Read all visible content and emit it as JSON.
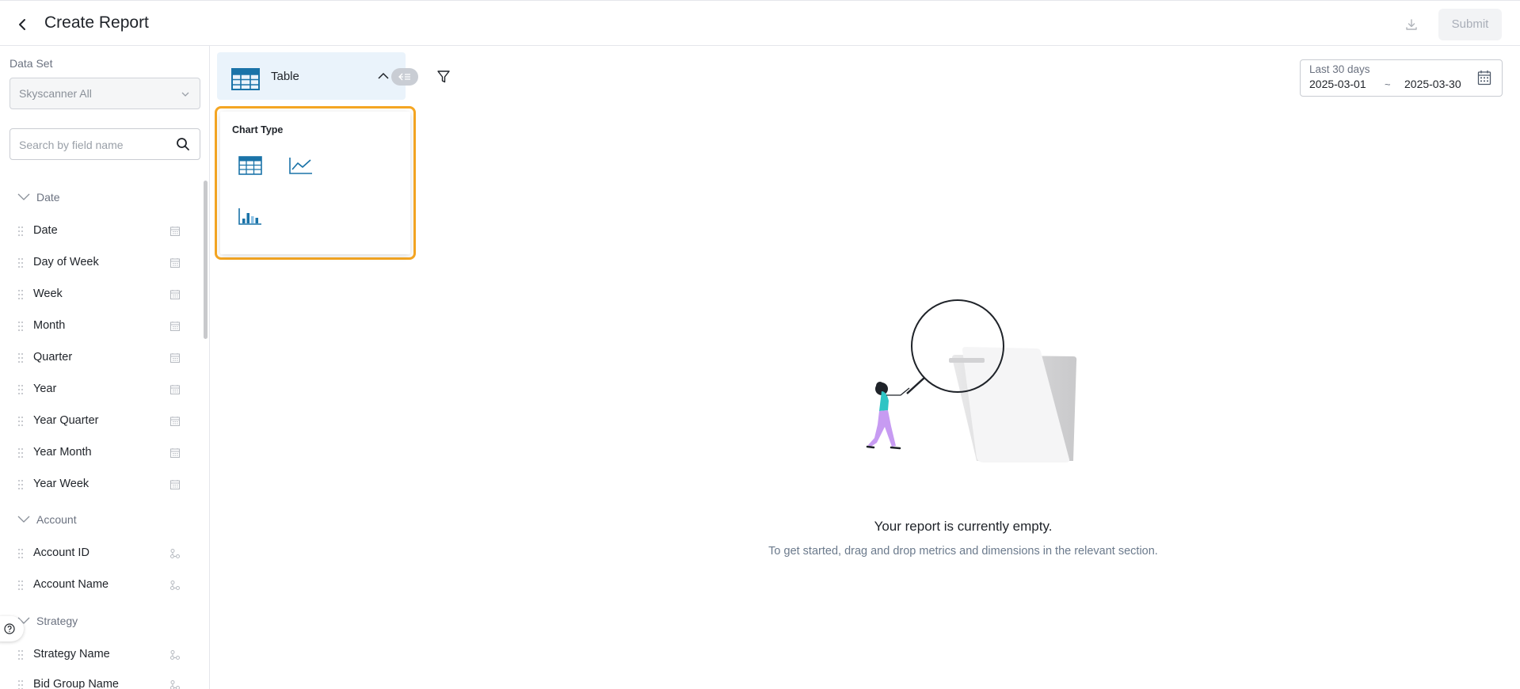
{
  "header": {
    "title": "Create Report",
    "submit_label": "Submit"
  },
  "sidebar": {
    "dataset_label": "Data Set",
    "dataset_value": "Skyscanner All",
    "search_placeholder": "Search by field name",
    "groups": [
      {
        "name": "Date",
        "fields": [
          "Date",
          "Day of Week",
          "Week",
          "Month",
          "Quarter",
          "Year",
          "Year Quarter",
          "Year Month",
          "Year Week"
        ]
      },
      {
        "name": "Account",
        "fields": [
          "Account ID",
          "Account Name"
        ]
      },
      {
        "name": "Strategy",
        "fields": [
          "Strategy Name",
          "Bid Group Name"
        ]
      }
    ]
  },
  "toolbar": {
    "chart_type_selected": "Table"
  },
  "chart_type_popover": {
    "title": "Chart Type",
    "options": [
      "table-icon",
      "line-chart-icon",
      "bar-chart-icon"
    ]
  },
  "date_range": {
    "label": "Last 30 days",
    "start": "2025-03-01",
    "separator": "~",
    "end": "2025-03-30"
  },
  "empty_state": {
    "title": "Your report is currently empty.",
    "subtitle": "To get started, drag and drop metrics and dimensions in the relevant section."
  },
  "colors": {
    "accent": "#1a73a8",
    "highlight_border": "#f5a623",
    "illustration_shirt": "#2ec4c4",
    "illustration_pants": "#c79bf2"
  }
}
